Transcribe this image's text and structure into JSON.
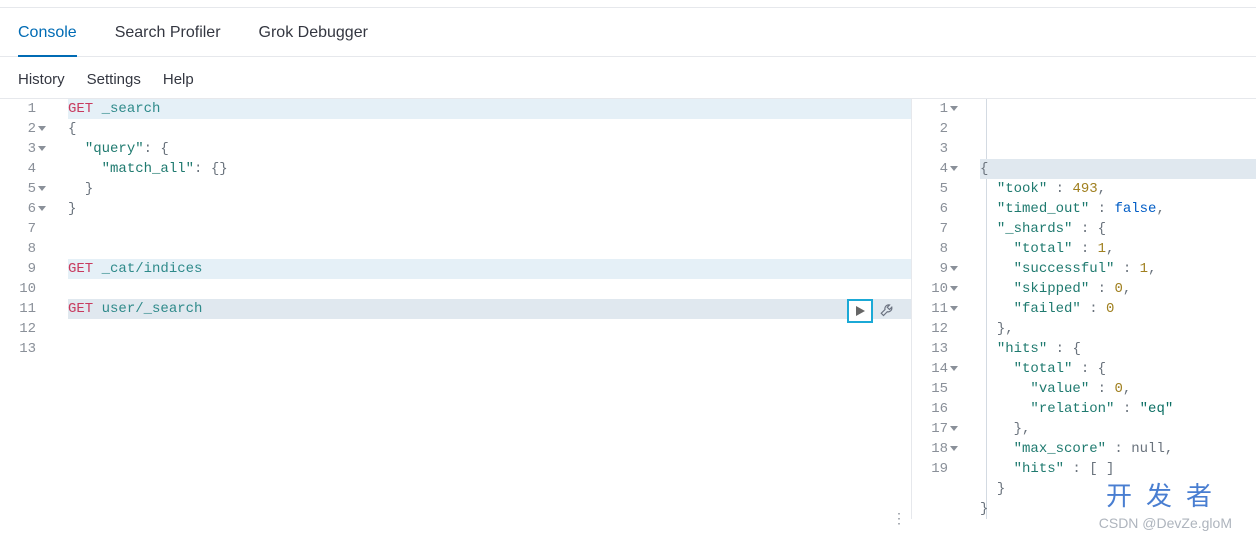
{
  "tabs": {
    "console": "Console",
    "profiler": "Search Profiler",
    "grok": "Grok Debugger"
  },
  "subtabs": {
    "history": "History",
    "settings": "Settings",
    "help": "Help"
  },
  "request": {
    "lines": [
      {
        "n": "1",
        "fold": false,
        "hl": true,
        "tokens": [
          [
            "kw",
            "GET"
          ],
          [
            "",
            " "
          ],
          [
            "path",
            "_search"
          ]
        ]
      },
      {
        "n": "2",
        "fold": true,
        "hl": false,
        "tokens": [
          [
            "punc",
            "{"
          ]
        ]
      },
      {
        "n": "3",
        "fold": true,
        "hl": false,
        "tokens": [
          [
            "",
            "  "
          ],
          [
            "key",
            "\"query\""
          ],
          [
            "punc",
            ": {"
          ]
        ]
      },
      {
        "n": "4",
        "fold": false,
        "hl": false,
        "tokens": [
          [
            "",
            "    "
          ],
          [
            "key",
            "\"match_all\""
          ],
          [
            "punc",
            ": {}"
          ]
        ]
      },
      {
        "n": "5",
        "fold": true,
        "hl": false,
        "tokens": [
          [
            "",
            "  "
          ],
          [
            "punc",
            "}"
          ]
        ]
      },
      {
        "n": "6",
        "fold": true,
        "hl": false,
        "tokens": [
          [
            "punc",
            "}"
          ]
        ]
      },
      {
        "n": "7",
        "fold": false,
        "hl": false,
        "tokens": []
      },
      {
        "n": "8",
        "fold": false,
        "hl": false,
        "tokens": []
      },
      {
        "n": "9",
        "fold": false,
        "hl": true,
        "tokens": [
          [
            "kw",
            "GET"
          ],
          [
            "",
            " "
          ],
          [
            "path",
            "_cat/indices"
          ]
        ]
      },
      {
        "n": "10",
        "fold": false,
        "hl": false,
        "tokens": []
      },
      {
        "n": "11",
        "fold": false,
        "hl": false,
        "sel": true,
        "tokens": [
          [
            "kw",
            "GET"
          ],
          [
            "",
            " "
          ],
          [
            "path",
            "user/_search"
          ]
        ]
      },
      {
        "n": "12",
        "fold": false,
        "hl": false,
        "tokens": []
      },
      {
        "n": "13",
        "fold": false,
        "hl": false,
        "tokens": []
      }
    ]
  },
  "response": {
    "lines": [
      {
        "n": "1",
        "fold": true,
        "sel": true,
        "tokens": [
          [
            "punc",
            "{"
          ]
        ]
      },
      {
        "n": "2",
        "fold": false,
        "tokens": [
          [
            "",
            "  "
          ],
          [
            "key",
            "\"took\""
          ],
          [
            "punc",
            " : "
          ],
          [
            "num",
            "493"
          ],
          [
            "punc",
            ","
          ]
        ]
      },
      {
        "n": "3",
        "fold": false,
        "tokens": [
          [
            "",
            "  "
          ],
          [
            "key",
            "\"timed_out\""
          ],
          [
            "punc",
            " : "
          ],
          [
            "bool",
            "false"
          ],
          [
            "punc",
            ","
          ]
        ]
      },
      {
        "n": "4",
        "fold": true,
        "tokens": [
          [
            "",
            "  "
          ],
          [
            "key",
            "\"_shards\""
          ],
          [
            "punc",
            " : {"
          ]
        ]
      },
      {
        "n": "5",
        "fold": false,
        "tokens": [
          [
            "",
            "    "
          ],
          [
            "key",
            "\"total\""
          ],
          [
            "punc",
            " : "
          ],
          [
            "num",
            "1"
          ],
          [
            "punc",
            ","
          ]
        ]
      },
      {
        "n": "6",
        "fold": false,
        "tokens": [
          [
            "",
            "    "
          ],
          [
            "key",
            "\"successful\""
          ],
          [
            "punc",
            " : "
          ],
          [
            "num",
            "1"
          ],
          [
            "punc",
            ","
          ]
        ]
      },
      {
        "n": "7",
        "fold": false,
        "tokens": [
          [
            "",
            "    "
          ],
          [
            "key",
            "\"skipped\""
          ],
          [
            "punc",
            " : "
          ],
          [
            "num",
            "0"
          ],
          [
            "punc",
            ","
          ]
        ]
      },
      {
        "n": "8",
        "fold": false,
        "tokens": [
          [
            "",
            "    "
          ],
          [
            "key",
            "\"failed\""
          ],
          [
            "punc",
            " : "
          ],
          [
            "num",
            "0"
          ]
        ]
      },
      {
        "n": "9",
        "fold": true,
        "tokens": [
          [
            "",
            "  "
          ],
          [
            "punc",
            "},"
          ]
        ]
      },
      {
        "n": "10",
        "fold": true,
        "tokens": [
          [
            "",
            "  "
          ],
          [
            "key",
            "\"hits\""
          ],
          [
            "punc",
            " : {"
          ]
        ]
      },
      {
        "n": "11",
        "fold": true,
        "tokens": [
          [
            "",
            "    "
          ],
          [
            "key",
            "\"total\""
          ],
          [
            "punc",
            " : {"
          ]
        ]
      },
      {
        "n": "12",
        "fold": false,
        "tokens": [
          [
            "",
            "      "
          ],
          [
            "key",
            "\"value\""
          ],
          [
            "punc",
            " : "
          ],
          [
            "num",
            "0"
          ],
          [
            "punc",
            ","
          ]
        ]
      },
      {
        "n": "13",
        "fold": false,
        "tokens": [
          [
            "",
            "      "
          ],
          [
            "key",
            "\"relation\""
          ],
          [
            "punc",
            " : "
          ],
          [
            "str",
            "\"eq\""
          ]
        ]
      },
      {
        "n": "14",
        "fold": true,
        "tokens": [
          [
            "",
            "    "
          ],
          [
            "punc",
            "},"
          ]
        ]
      },
      {
        "n": "15",
        "fold": false,
        "tokens": [
          [
            "",
            "    "
          ],
          [
            "key",
            "\"max_score\""
          ],
          [
            "punc",
            " : "
          ],
          [
            "null",
            "null"
          ],
          [
            "punc",
            ","
          ]
        ]
      },
      {
        "n": "16",
        "fold": false,
        "tokens": [
          [
            "",
            "    "
          ],
          [
            "key",
            "\"hits\""
          ],
          [
            "punc",
            " : [ ]"
          ]
        ]
      },
      {
        "n": "17",
        "fold": true,
        "tokens": [
          [
            "",
            "  "
          ],
          [
            "punc",
            "}"
          ]
        ]
      },
      {
        "n": "18",
        "fold": true,
        "tokens": [
          [
            "punc",
            "}"
          ]
        ]
      },
      {
        "n": "19",
        "fold": false,
        "tokens": []
      }
    ]
  },
  "watermark": {
    "brand": "开发者",
    "credit": "CSDN @DevZe.gloM"
  }
}
